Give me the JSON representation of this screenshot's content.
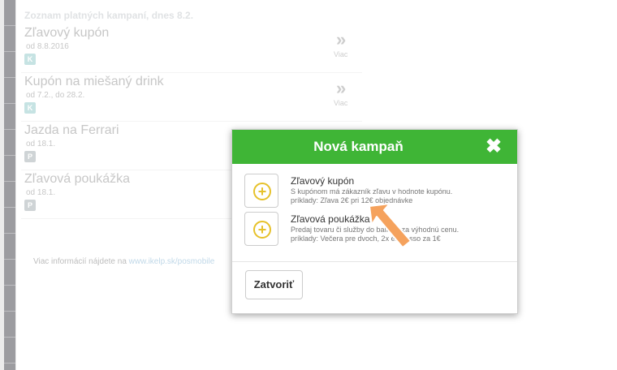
{
  "list": {
    "heading": "Zoznam platných kampaní, dnes 8.2.",
    "items": [
      {
        "title": "Zľavový kupón",
        "date": "od 8.8.2016",
        "badge": "K",
        "more": "Viac"
      },
      {
        "title": "Kupón na miešaný drink",
        "date": "od 7.2., do 28.2.",
        "badge": "K",
        "more": "Viac"
      },
      {
        "title": "Jazda na Ferrari",
        "date": "od 18.1.",
        "badge": "P"
      },
      {
        "title": "Zľavová poukážka",
        "date": "od 18.1.",
        "badge": "P"
      }
    ],
    "info_text": "Viac informácií nájdete na ",
    "info_link": "www.ikelp.sk/posmobile"
  },
  "modal": {
    "title": "Nová kampaň",
    "close_icon": "close-x-icon",
    "options": [
      {
        "title": "Zľavový kupón",
        "line1": "S kupónom má zákazník zľavu v hodnote kupónu.",
        "line2": "príklady: Zľava 2€ pri 12€ objednávke",
        "icon": "plus-circle-icon"
      },
      {
        "title": "Zľavová poukážka",
        "line1": "Predaj tovaru či služby do balíčku za výhodnú cenu.",
        "line2": "príklady: Večera pre dvoch, 2x espresso za 1€",
        "icon": "plus-circle-icon"
      }
    ],
    "close_button": "Zatvoriť"
  },
  "colors": {
    "header_green": "#3fb536",
    "plus_yellow": "#e6c12a",
    "arrow_orange": "#f5a25d"
  }
}
